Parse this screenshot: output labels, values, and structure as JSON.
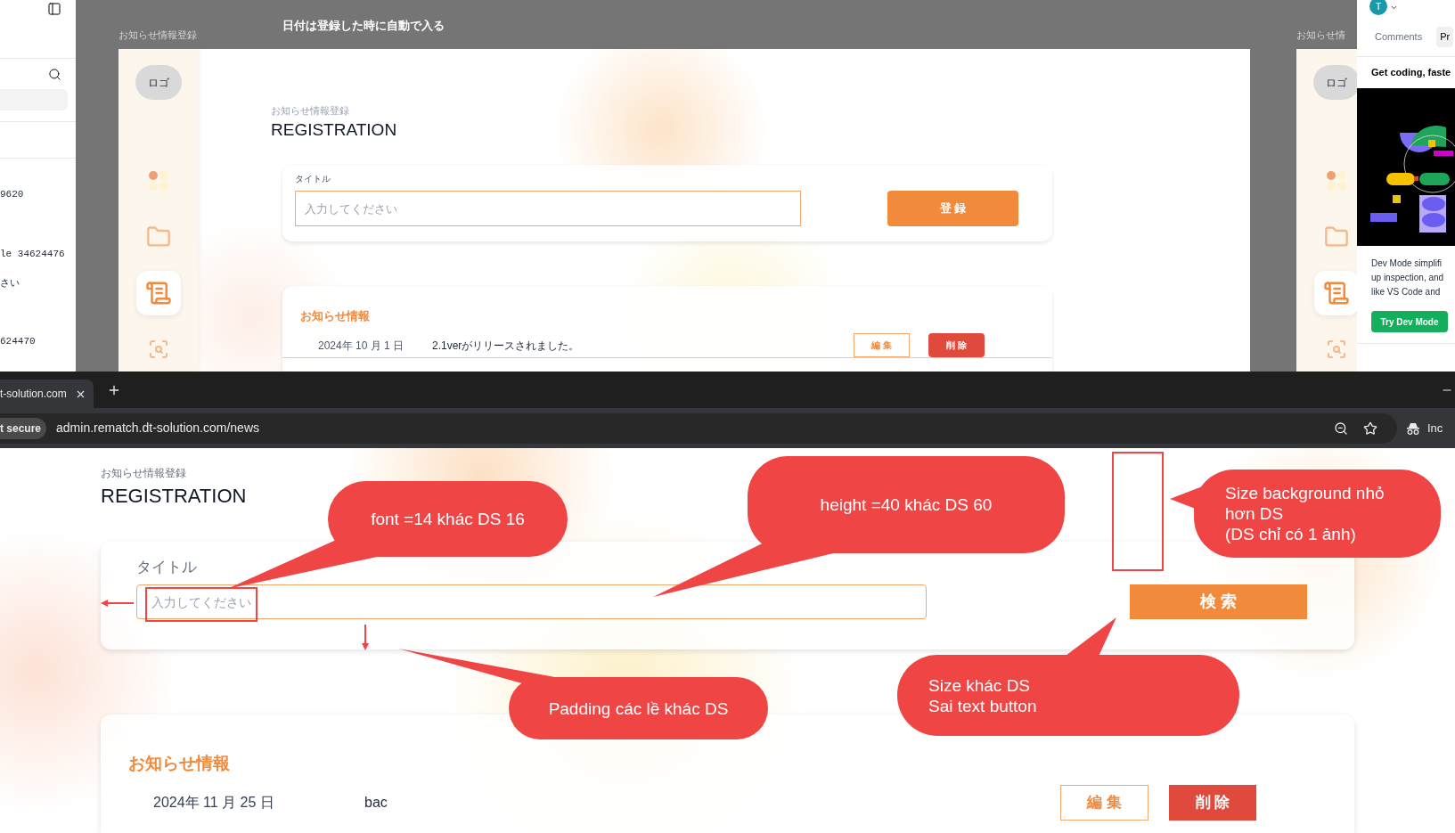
{
  "layers_panel": {
    "rows": [
      "9620",
      "le 34624476",
      "さい",
      "624470"
    ]
  },
  "canvas": {
    "frame_label": "お知らせ情報登録",
    "note": "日付は登録した時に自動で入る",
    "design": {
      "logo": "ロゴ",
      "nav": [
        {
          "kind": "dots",
          "selected": false
        },
        {
          "kind": "folder",
          "selected": false
        },
        {
          "kind": "document",
          "selected": true
        },
        {
          "kind": "search",
          "selected": false
        }
      ],
      "subtitle": "お知らせ情報登録",
      "title": "REGISTRATION",
      "form": {
        "label": "タイトル",
        "placeholder": "入力してください",
        "button": "登 録"
      },
      "list": {
        "heading": "お知らせ情報",
        "rows": [
          {
            "date": "2024年 10 月 1 日",
            "text": "2.1verがリリースされました。",
            "edit": "編 集",
            "delete": "削 除"
          }
        ]
      }
    },
    "second_frame": {
      "label": "お知らせ情",
      "logo": "ロゴ"
    }
  },
  "inspect_panel": {
    "avatar": "T",
    "tabs": [
      {
        "label": "Comments",
        "selected": false
      },
      {
        "label": "Pr",
        "selected": true
      }
    ],
    "heading": "Get coding, faste",
    "body": [
      "Dev Mode simplifi",
      "up inspection, and",
      "like VS Code and"
    ],
    "button": "Try Dev Mode"
  },
  "browser": {
    "tab": "t-solution.com",
    "security": "t secure",
    "url": "admin.rematch.dt-solution.com/news",
    "profile": "Inc"
  },
  "page": {
    "subtitle": "お知らせ情報登録",
    "title": "REGISTRATION",
    "form": {
      "label": "タイトル",
      "placeholder": "入力してください",
      "button": "検 索"
    },
    "list": {
      "heading": "お知らせ情報",
      "rows": [
        {
          "date": "2024年 11 月 25 日",
          "text": "bac",
          "edit": "編 集",
          "delete": "削 除"
        }
      ]
    }
  },
  "annotations": [
    {
      "lines": [
        "font =14 khác DS 16"
      ]
    },
    {
      "lines": [
        "height =40 khác DS 60"
      ]
    },
    {
      "lines": [
        "Size background nhỏ hơn DS",
        "(DS chỉ có 1 ảnh)"
      ]
    },
    {
      "lines": [
        "Padding các lề khác DS"
      ]
    },
    {
      "lines": [
        "Size khác DS",
        "Sai text button"
      ]
    }
  ]
}
